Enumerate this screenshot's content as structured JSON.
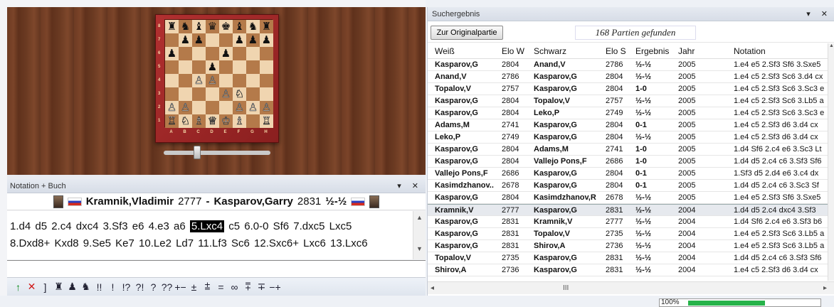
{
  "board": {
    "ranks": [
      "8",
      "7",
      "6",
      "5",
      "4",
      "3",
      "2",
      "1"
    ],
    "files": [
      "A",
      "B",
      "C",
      "D",
      "E",
      "F",
      "G",
      "H"
    ],
    "squares": [
      [
        "♜",
        "♞",
        "♝",
        "♛",
        "♚",
        "♝",
        "♞",
        "♜"
      ],
      [
        "",
        "♟",
        "♟",
        "",
        "",
        "♟",
        "♟",
        "♟"
      ],
      [
        "♟",
        "",
        "",
        "",
        "♟",
        "",
        "",
        ""
      ],
      [
        "",
        "",
        "",
        "♟",
        "",
        "",
        "",
        ""
      ],
      [
        "",
        "",
        "♙",
        "♙",
        "",
        "",
        "",
        ""
      ],
      [
        "",
        "",
        "",
        "",
        "♙",
        "♘",
        "",
        ""
      ],
      [
        "♙",
        "♙",
        "",
        "",
        "",
        "♙",
        "♙",
        "♙"
      ],
      [
        "♖",
        "♘",
        "♗",
        "♕",
        "♔",
        "♗",
        "",
        "♖"
      ]
    ]
  },
  "slider": {
    "value_fraction": 0.3
  },
  "notation": {
    "title": "Notation + Buch",
    "controls": "▾ ✕",
    "white": "Kramnik,Vladimir",
    "white_elo": "2777",
    "separator": "-",
    "black": "Kasparov,Garry",
    "black_elo": "2831",
    "result": "½-½",
    "moves_before": "1.d4 d5 2.c4 dxc4 3.Sf3 e6 4.e3 a6",
    "current_move": "5.Lxc4",
    "moves_after": "c5 6.0-0 Sf6 7.dxc5 Lxc5",
    "moves_line2": "8.Dxd8+ Kxd8 9.Se5 Ke7 10.Le2 Ld7 11.Lf3 Sc6 12.Sxc6+ Lxc6 13.Lxc6"
  },
  "toolbar": [
    "↑",
    "✕",
    "]",
    "♜",
    "♟",
    "♞",
    "!!",
    "!",
    "!?",
    "?!",
    "?",
    "??",
    "+−",
    "±",
    "⩲",
    "=",
    "∞",
    "⩱",
    "∓",
    "−+"
  ],
  "results": {
    "title": "Suchergebnis",
    "controls": "▾ ✕",
    "button_original": "Zur Originalpartie",
    "found_text": "168 Partien gefunden",
    "headers": [
      "Weiß",
      "Elo W",
      "Schwarz",
      "Elo S",
      "Ergebnis",
      "Jahr",
      "Notation"
    ],
    "rows": [
      [
        "Kasparov,G",
        "2804",
        "Anand,V",
        "2786",
        "½-½",
        "2005",
        "1.e4 e5 2.Sf3 Sf6 3.Sxe5"
      ],
      [
        "Anand,V",
        "2786",
        "Kasparov,G",
        "2804",
        "½-½",
        "2005",
        "1.e4 c5 2.Sf3 Sc6 3.d4 cx"
      ],
      [
        "Topalov,V",
        "2757",
        "Kasparov,G",
        "2804",
        "1-0",
        "2005",
        "1.e4 c5 2.Sf3 Sc6 3.Sc3 e"
      ],
      [
        "Kasparov,G",
        "2804",
        "Topalov,V",
        "2757",
        "½-½",
        "2005",
        "1.e4 c5 2.Sf3 Sc6 3.Lb5 a"
      ],
      [
        "Kasparov,G",
        "2804",
        "Leko,P",
        "2749",
        "½-½",
        "2005",
        "1.e4 c5 2.Sf3 Sc6 3.Sc3 e"
      ],
      [
        "Adams,M",
        "2741",
        "Kasparov,G",
        "2804",
        "0-1",
        "2005",
        "1.e4 c5 2.Sf3 d6 3.d4 cx"
      ],
      [
        "Leko,P",
        "2749",
        "Kasparov,G",
        "2804",
        "½-½",
        "2005",
        "1.e4 c5 2.Sf3 d6 3.d4 cx"
      ],
      [
        "Kasparov,G",
        "2804",
        "Adams,M",
        "2741",
        "1-0",
        "2005",
        "1.d4 Sf6 2.c4 e6 3.Sc3 Lt"
      ],
      [
        "Kasparov,G",
        "2804",
        "Vallejo Pons,F",
        "2686",
        "1-0",
        "2005",
        "1.d4 d5 2.c4 c6 3.Sf3 Sf6"
      ],
      [
        "Vallejo Pons,F",
        "2686",
        "Kasparov,G",
        "2804",
        "0-1",
        "2005",
        "1.Sf3 d5 2.d4 e6 3.c4 dx"
      ],
      [
        "Kasimdzhanov..",
        "2678",
        "Kasparov,G",
        "2804",
        "0-1",
        "2005",
        "1.d4 d5 2.c4 c6 3.Sc3 Sf"
      ],
      [
        "Kasparov,G",
        "2804",
        "Kasimdzhanov,R",
        "2678",
        "½-½",
        "2005",
        "1.e4 e5 2.Sf3 Sf6 3.Sxe5"
      ],
      [
        "Kramnik,V",
        "2777",
        "Kasparov,G",
        "2831",
        "½-½",
        "2004",
        "1.d4 d5 2.c4 dxc4 3.Sf3"
      ],
      [
        "Kasparov,G",
        "2831",
        "Kramnik,V",
        "2777",
        "½-½",
        "2004",
        "1.d4 Sf6 2.c4 e6 3.Sf3 b6"
      ],
      [
        "Kasparov,G",
        "2831",
        "Topalov,V",
        "2735",
        "½-½",
        "2004",
        "1.e4 e5 2.Sf3 Sc6 3.Lb5 a"
      ],
      [
        "Kasparov,G",
        "2831",
        "Shirov,A",
        "2736",
        "½-½",
        "2004",
        "1.e4 e5 2.Sf3 Sc6 3.Lb5 a"
      ],
      [
        "Topalov,V",
        "2735",
        "Kasparov,G",
        "2831",
        "½-½",
        "2004",
        "1.d4 d5 2.c4 c6 3.Sf3 Sf6"
      ],
      [
        "Shirov,A",
        "2736",
        "Kasparov,G",
        "2831",
        "½-½",
        "2004",
        "1.e4 c5 2.Sf3 d6 3.d4 cx"
      ]
    ],
    "selected_row": 12,
    "hscroll_label": "III"
  },
  "status": {
    "progress_label": "100%",
    "progress_fraction": 0.6
  },
  "colors": {
    "accent": "#27b34a",
    "board_light": "#f0d5b0",
    "board_dark": "#b47a4a",
    "frame": "#b23030"
  }
}
